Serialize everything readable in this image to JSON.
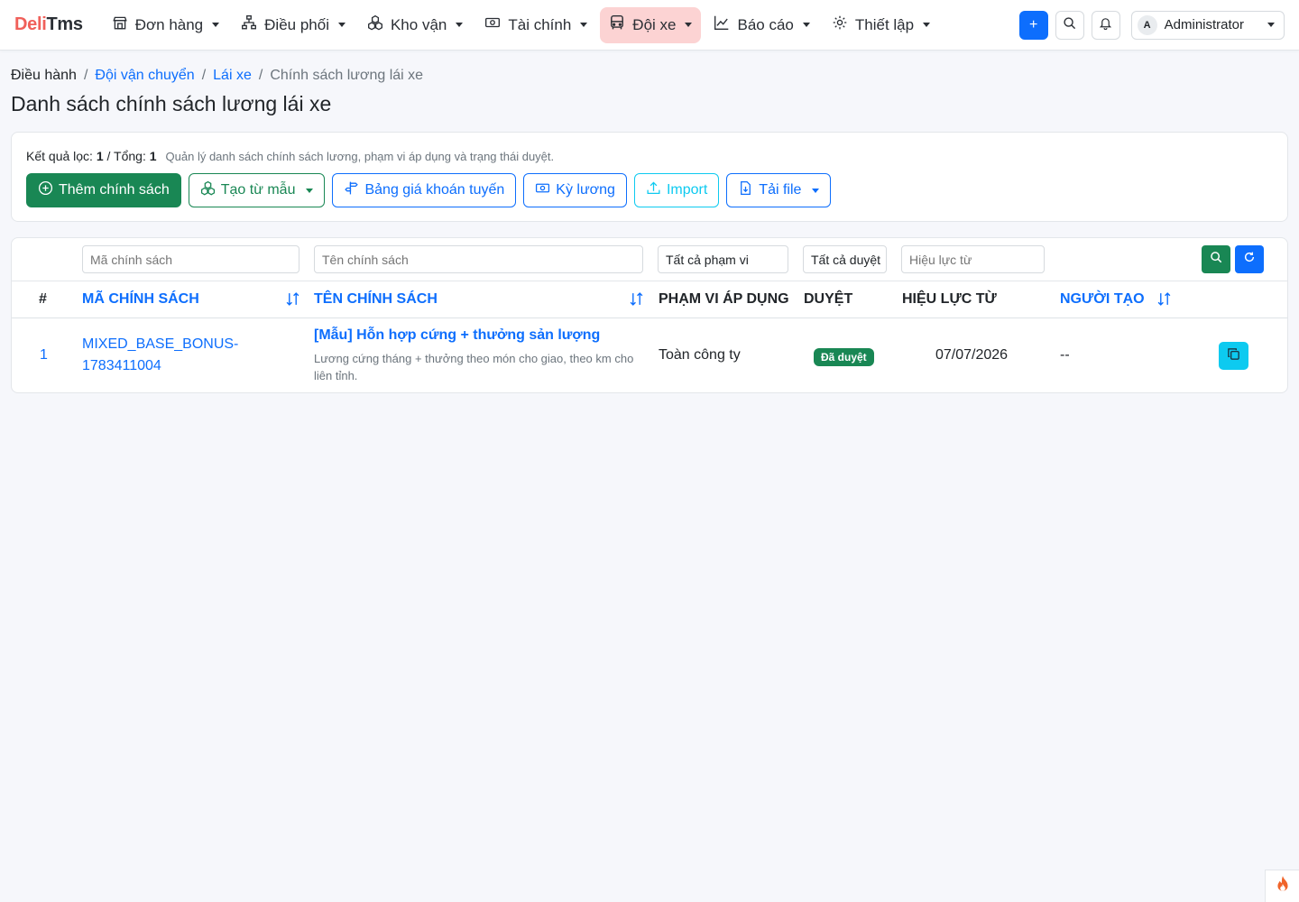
{
  "brand": {
    "part1": "Deli",
    "part2": "Tms"
  },
  "nav": {
    "items": [
      {
        "label": "Đơn hàng",
        "icon": "shop-icon"
      },
      {
        "label": "Điều phối",
        "icon": "diagram-icon"
      },
      {
        "label": "Kho vận",
        "icon": "boxes-icon"
      },
      {
        "label": "Tài chính",
        "icon": "cash-icon"
      },
      {
        "label": "Đội xe",
        "icon": "bus-icon",
        "active": true
      },
      {
        "label": "Báo cáo",
        "icon": "chart-line-icon"
      },
      {
        "label": "Thiết lập",
        "icon": "gear-icon"
      }
    ],
    "add_label": "+",
    "user_initial": "A",
    "user_name": "Administrator"
  },
  "breadcrumb": {
    "root": "Điều hành",
    "level1": "Đội vận chuyển",
    "level2": "Lái xe",
    "current": "Chính sách lương lái xe",
    "separator": "/"
  },
  "page_title": "Danh sách chính sách lương lái xe",
  "summary": {
    "filter_label": "Kết quả lọc:",
    "filter_count": "1",
    "total_label": "/ Tổng:",
    "total_count": "1",
    "description": "Quản lý danh sách chính sách lương, phạm vi áp dụng và trạng thái duyệt."
  },
  "toolbar": {
    "add": "Thêm chính sách",
    "from_template": "Tạo từ mẫu",
    "route_price": "Bảng giá khoán tuyến",
    "pay_period": "Kỳ lương",
    "import": "Import",
    "download": "Tải file"
  },
  "filters": {
    "code_placeholder": "Mã chính sách",
    "name_placeholder": "Tên chính sách",
    "scope_value": "Tất cả phạm vi",
    "approval_value": "Tất cả duyệt",
    "effective_placeholder": "Hiệu lực từ"
  },
  "columns": {
    "index": "#",
    "code": "Mã chính sách",
    "name": "Tên chính sách",
    "scope": "Phạm vi áp dụng",
    "approval": "Duyệt",
    "effective": "Hiệu lực từ",
    "creator": "Người tạo"
  },
  "rows": [
    {
      "index": "1",
      "code_line1": "MIXED_BASE_BONUS-",
      "code_line2": "1783411004",
      "name": "[Mẫu] Hỗn hợp cứng + thưởng sản lượng",
      "description": "Lương cứng tháng + thưởng theo món cho giao, theo km cho liên tỉnh.",
      "scope": "Toàn công ty",
      "approval": "Đã duyệt",
      "effective": "07/07/2026",
      "creator": "--"
    }
  ],
  "colors": {
    "brand_red": "#f0605a",
    "primary": "#0d6efd",
    "success": "#198754",
    "info": "#0dcaf0",
    "active_nav_bg": "#fcd3d3"
  }
}
